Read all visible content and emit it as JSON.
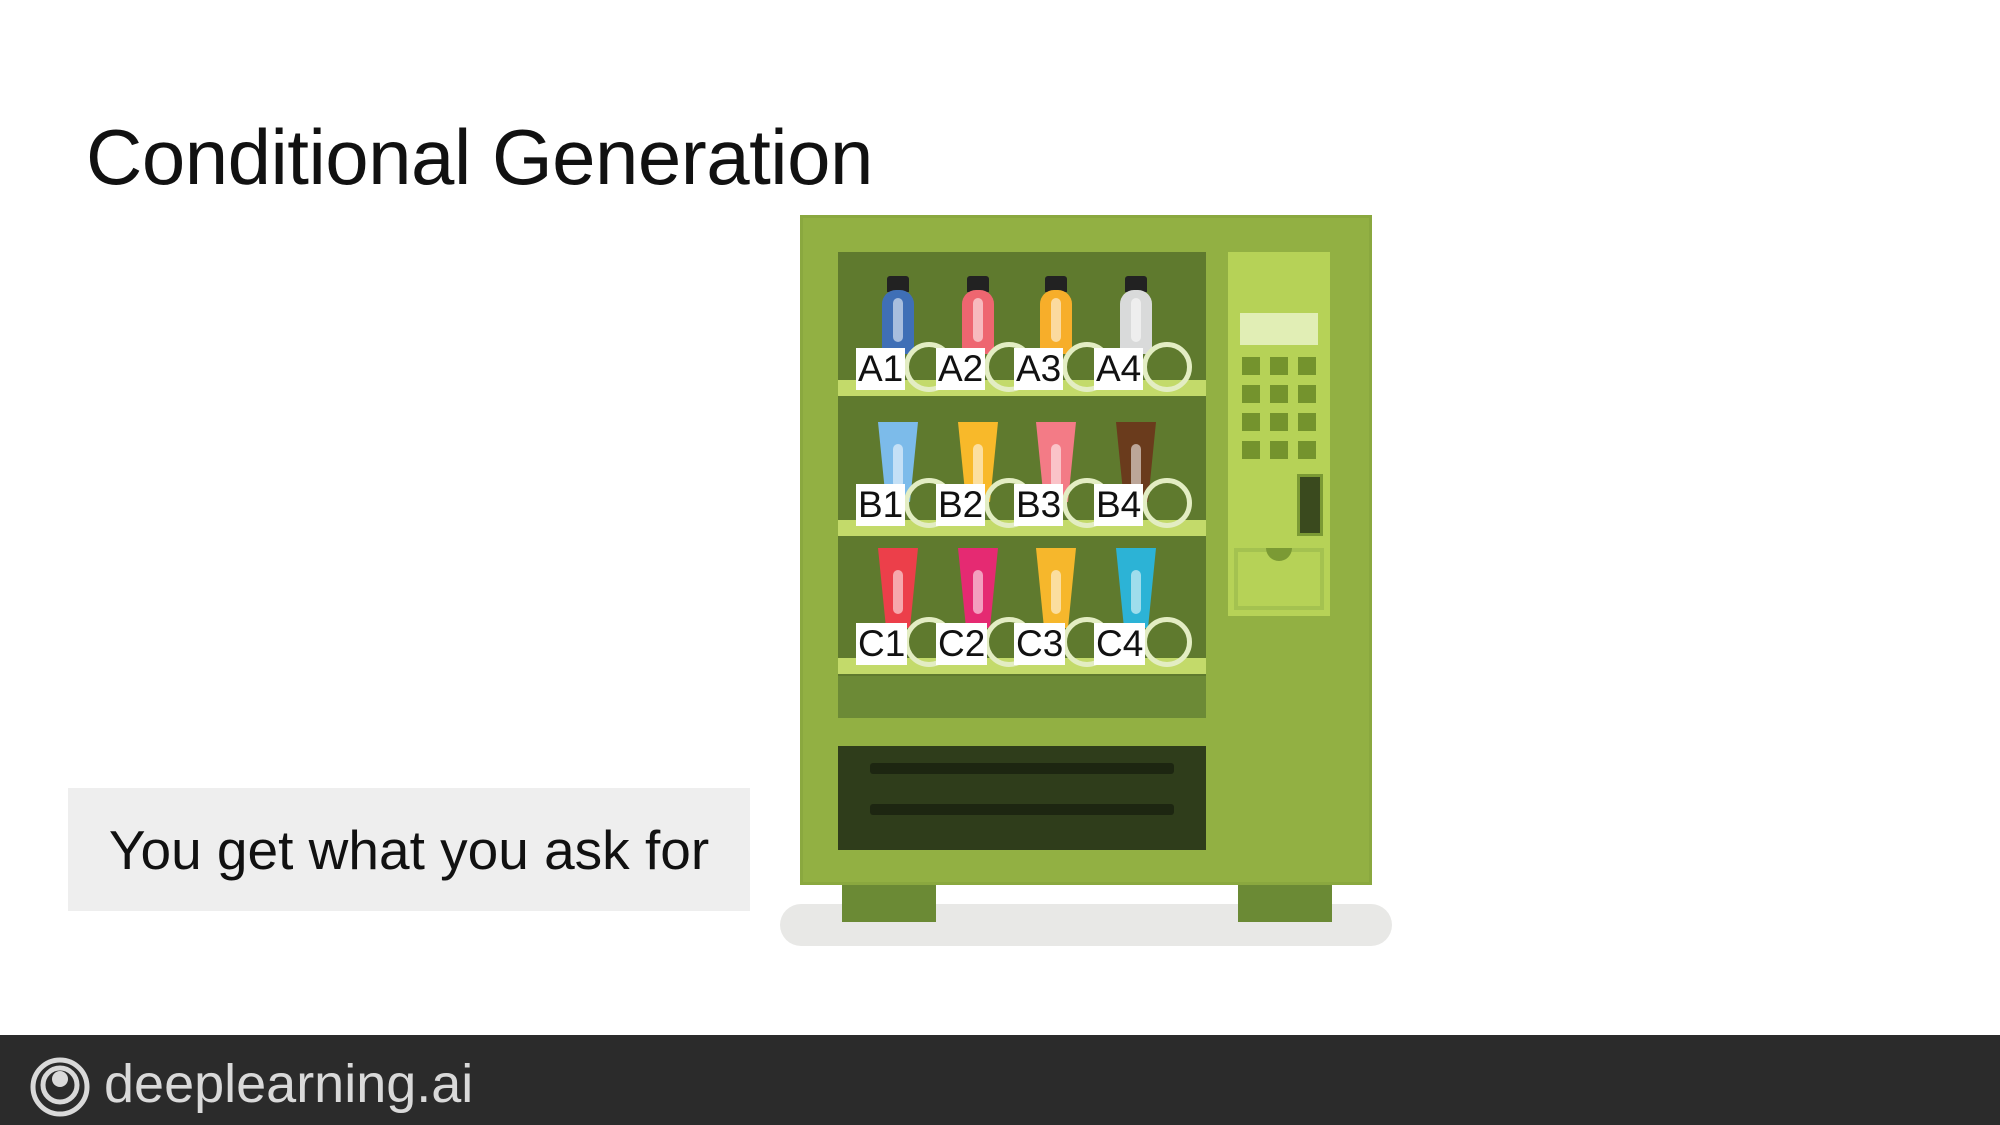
{
  "slide": {
    "title": "Conditional Generation",
    "callout": "You get what you ask for"
  },
  "machine": {
    "slots": [
      {
        "code": "A1",
        "kind": "bottle",
        "color": "#3f6fb6"
      },
      {
        "code": "A2",
        "kind": "bottle",
        "color": "#ee6670"
      },
      {
        "code": "A3",
        "kind": "bottle",
        "color": "#f7ae2a"
      },
      {
        "code": "A4",
        "kind": "bottle",
        "color": "#d9dada"
      },
      {
        "code": "B1",
        "kind": "tube",
        "color": "#7cbbea"
      },
      {
        "code": "B2",
        "kind": "tube",
        "color": "#f8b92a"
      },
      {
        "code": "B3",
        "kind": "tube",
        "color": "#f37b86"
      },
      {
        "code": "B4",
        "kind": "tube",
        "color": "#6a3b1c"
      },
      {
        "code": "C1",
        "kind": "tube",
        "color": "#ec3f4a"
      },
      {
        "code": "C2",
        "kind": "tube",
        "color": "#e52a72"
      },
      {
        "code": "C3",
        "kind": "tube",
        "color": "#f6b72c"
      },
      {
        "code": "C4",
        "kind": "tube",
        "color": "#2cb3d6"
      }
    ],
    "colors": {
      "body": "#92b043",
      "window": "#5f7a2e",
      "shelf": "#c3da6a",
      "panel": "#b6d257",
      "tray": "#2f3d1b"
    }
  },
  "footer": {
    "brand": "deeplearning.ai",
    "logo_icon": "deeplearning-ai-logo-icon",
    "background": "#2b2b2b"
  }
}
